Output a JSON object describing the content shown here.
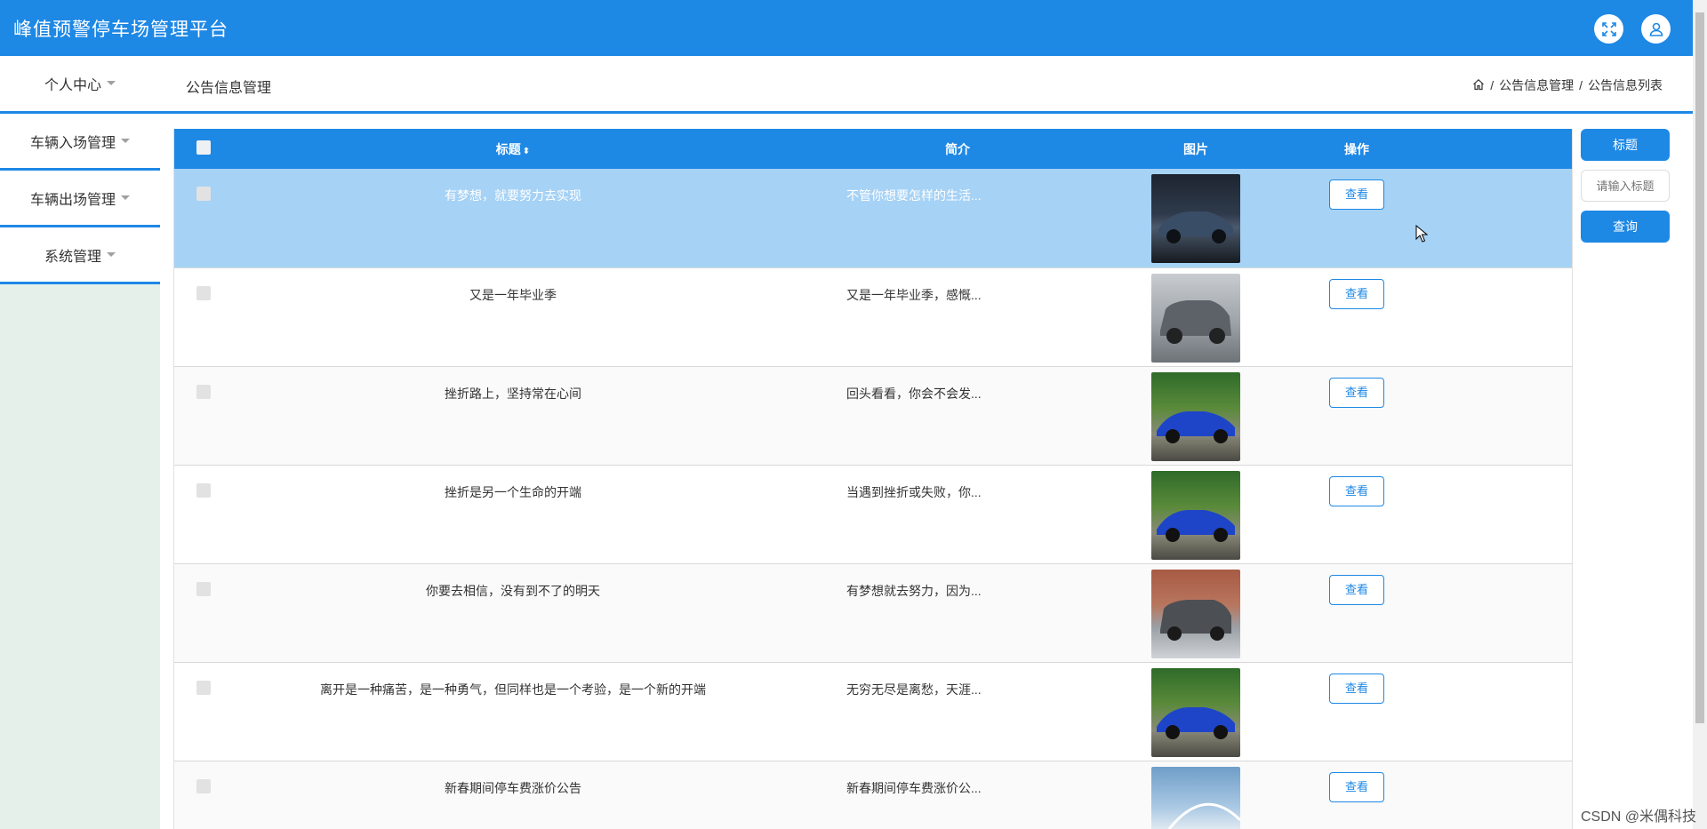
{
  "app": {
    "title": "峰值预警停车场管理平台"
  },
  "header": {
    "fullscreen_icon": "fullscreen-icon",
    "user_icon": "user-icon"
  },
  "nav": {
    "personal_center": "个人中心",
    "page_title": "公告信息管理",
    "breadcrumb": [
      "公告信息管理",
      "公告信息列表"
    ],
    "home_icon": "home-icon"
  },
  "sidebar": {
    "items": [
      {
        "label": "车辆入场管理"
      },
      {
        "label": "车辆出场管理"
      },
      {
        "label": "系统管理"
      }
    ]
  },
  "table": {
    "headers": {
      "title": "标题",
      "brief": "简介",
      "image": "图片",
      "action": "操作"
    },
    "rows": [
      {
        "title": "有梦想，就要努力去实现",
        "brief": "不管你想要怎样的生活...",
        "image": "dark-sedan",
        "action": "查看",
        "selected": true
      },
      {
        "title": "又是一年毕业季",
        "brief": "又是一年毕业季，感慨...",
        "image": "grey-suv",
        "action": "查看"
      },
      {
        "title": "挫折路上，坚持常在心间",
        "brief": "回头看看，你会不会发...",
        "image": "blue-sports-car",
        "action": "查看"
      },
      {
        "title": "挫折是另一个生命的开端",
        "brief": "当遇到挫折或失败，你...",
        "image": "blue-sports-car",
        "action": "查看"
      },
      {
        "title": "你要去相信，没有到不了的明天",
        "brief": "有梦想就去努力，因为...",
        "image": "grey-minivan",
        "action": "查看"
      },
      {
        "title": "离开是一种痛苦，是一种勇气，但同样也是一个考验，是一个新的开端",
        "brief": "无穷无尽是离愁，天涯...",
        "image": "blue-sports-car",
        "action": "查看"
      },
      {
        "title": "新春期间停车费涨价公告",
        "brief": "新春期间停车费涨价公...",
        "image": "bridge-landscape",
        "action": "查看"
      }
    ]
  },
  "search": {
    "field_label": "标题",
    "placeholder": "请输入标题",
    "query_button": "查询"
  },
  "watermark": "CSDN @米偶科技",
  "colors": {
    "primary": "#1e88e5",
    "selected_row": "#a6d2f5",
    "sidebar_bg": "#e6f0ea"
  }
}
